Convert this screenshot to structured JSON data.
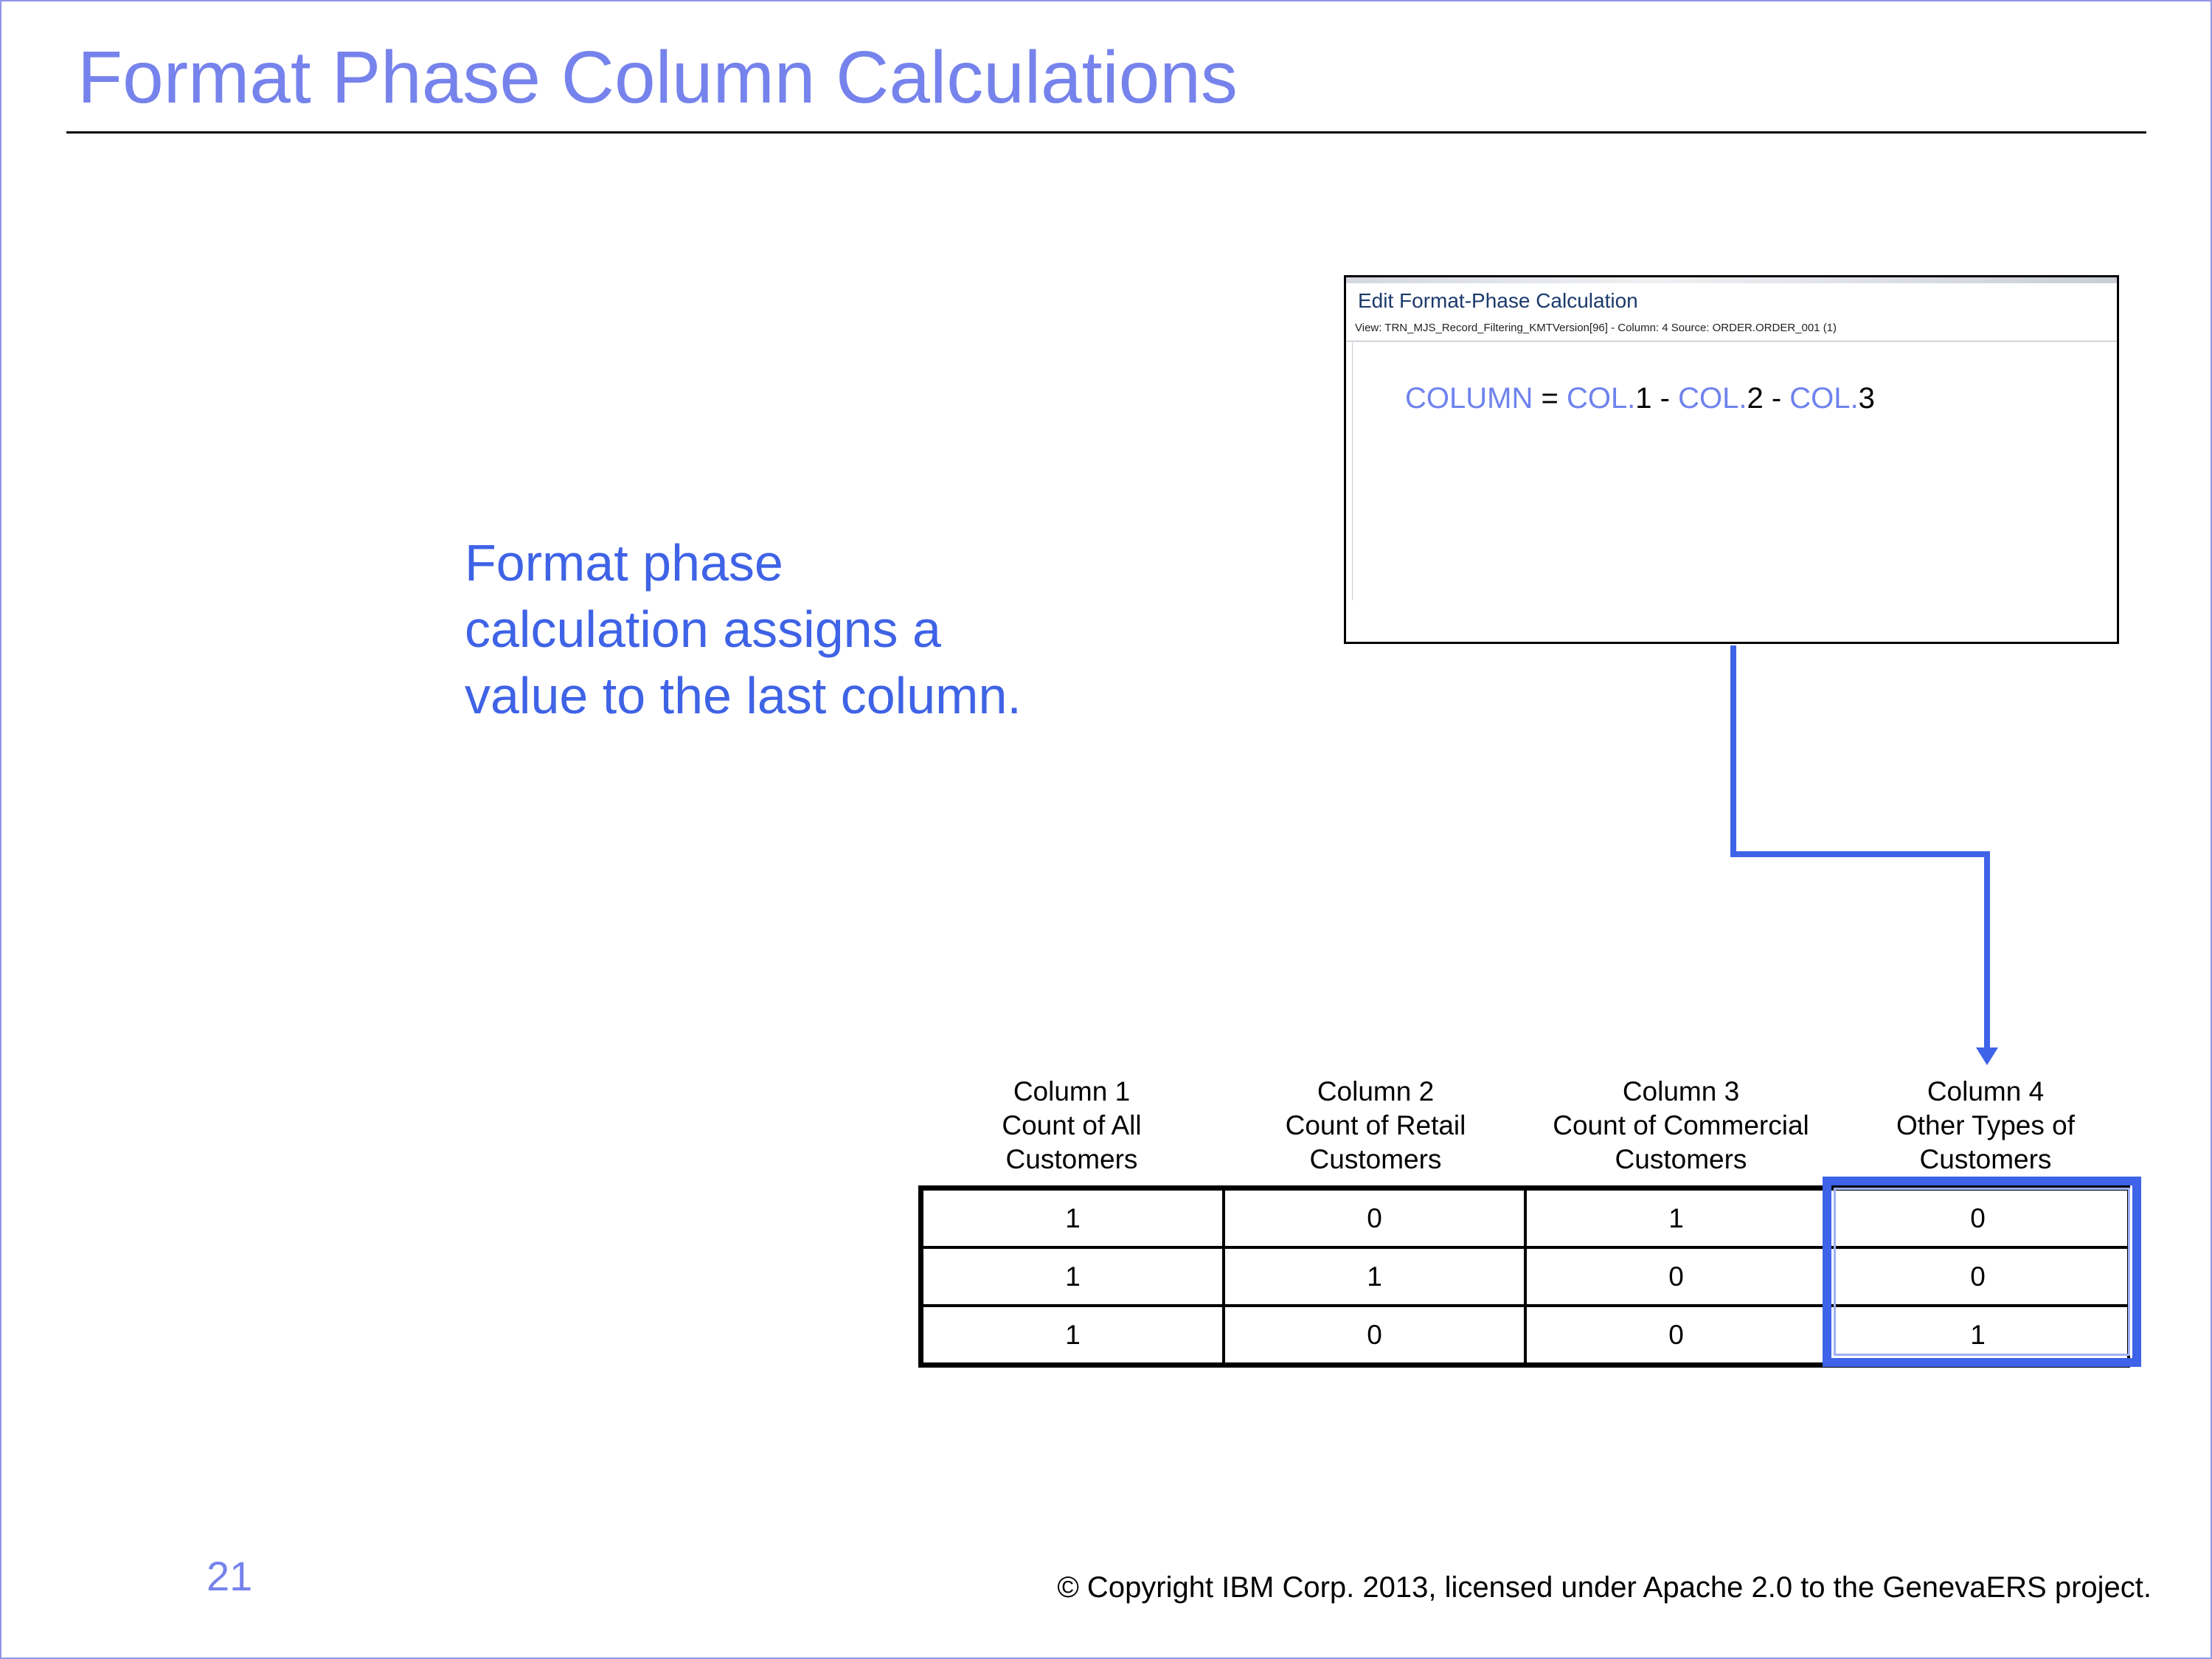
{
  "slide": {
    "title": "Format Phase Column Calculations",
    "callout": "Format phase calculation assigns a value to the last column.",
    "page_number": "21",
    "copyright": "© Copyright IBM Corp. 2013, licensed under Apache 2.0 to the GenevaERS project."
  },
  "dialog": {
    "title": "Edit Format-Phase Calculation",
    "subtitle": "View: TRN_MJS_Record_Filtering_KMTVersion[96] - Column: 4 Source: ORDER.ORDER_001 (1)",
    "formula": {
      "lhs": "COLUMN",
      "eq": " = ",
      "kw1": "COL.",
      "n1": "1",
      "minus1": " - ",
      "kw2": "COL.",
      "n2": "2",
      "minus2": " - ",
      "kw3": "COL.",
      "n3": "3"
    }
  },
  "table": {
    "headers": [
      [
        "Column 1",
        "Count of All",
        "Customers"
      ],
      [
        "Column 2",
        "Count of Retail",
        "Customers"
      ],
      [
        "Column 3",
        "Count of Commercial",
        "Customers"
      ],
      [
        "Column 4",
        "Other Types of",
        "Customers"
      ]
    ],
    "rows": [
      [
        "1",
        "0",
        "1",
        "0"
      ],
      [
        "1",
        "1",
        "0",
        "0"
      ],
      [
        "1",
        "0",
        "0",
        "1"
      ]
    ]
  },
  "colors": {
    "title": "#7683ec",
    "callout": "#3f63e6",
    "accent": "#3e63e8",
    "formula_keyword": "#6f83ee"
  },
  "icons": [
    "arrow-down-icon"
  ]
}
